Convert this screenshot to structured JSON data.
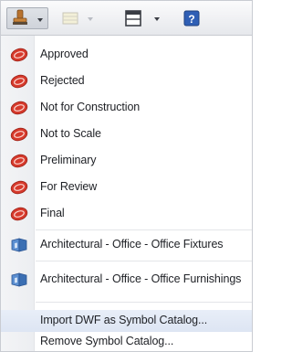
{
  "toolbar": {
    "buttons": [
      {
        "icon": "stamp-icon",
        "has_dropdown": true
      },
      {
        "icon": "layout-icon",
        "has_dropdown": true
      },
      {
        "icon": "window-split-icon",
        "has_dropdown": true
      },
      {
        "icon": "help-icon",
        "has_dropdown": false
      }
    ]
  },
  "menu": {
    "stamps": [
      {
        "label": "Approved",
        "icon": "stamp-red-icon"
      },
      {
        "label": "Rejected",
        "icon": "stamp-red-icon"
      },
      {
        "label": "Not for Construction",
        "icon": "stamp-red-icon"
      },
      {
        "label": "Not to Scale",
        "icon": "stamp-red-icon"
      },
      {
        "label": "Preliminary",
        "icon": "stamp-red-icon"
      },
      {
        "label": "For Review",
        "icon": "stamp-red-icon"
      },
      {
        "label": "Final",
        "icon": "stamp-red-icon"
      }
    ],
    "catalogs": [
      {
        "label": "Architectural - Office - Office Fixtures",
        "icon": "symbol-catalog-icon"
      },
      {
        "label": "Architectural - Office - Office Furnishings",
        "icon": "symbol-catalog-icon"
      }
    ],
    "actions": [
      {
        "label": "Import DWF as Symbol Catalog..."
      },
      {
        "label": "Remove Symbol Catalog..."
      }
    ]
  },
  "colors": {
    "stamp_red": "#d63a2c",
    "catalog_blue": "#3b6fb3",
    "help_blue": "#2f5fb5",
    "hover_bg": "#dde5f3"
  }
}
